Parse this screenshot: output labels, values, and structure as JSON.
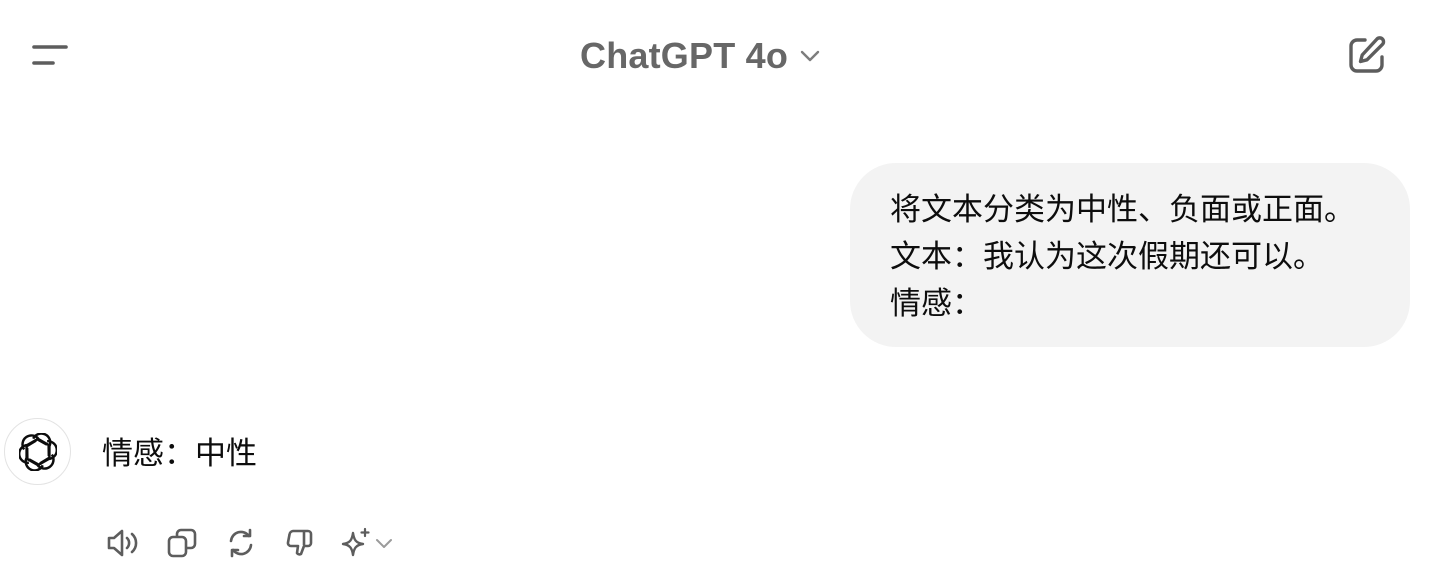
{
  "header": {
    "model_title": "ChatGPT 4o",
    "menu_icon": "sidebar-menu-icon",
    "dropdown_icon": "chevron-down-icon",
    "new_chat_icon": "edit-pencil-icon"
  },
  "conversation": {
    "user_message": {
      "lines": [
        "将文本分类为中性、负面或正面。",
        "文本：我认为这次假期还可以。",
        "情感："
      ]
    },
    "assistant_message": {
      "avatar_icon": "openai-logo-icon",
      "text": "情感：中性"
    },
    "actions": [
      {
        "name": "read-aloud",
        "icon": "speaker-icon"
      },
      {
        "name": "copy",
        "icon": "copy-icon"
      },
      {
        "name": "regenerate",
        "icon": "refresh-icon"
      },
      {
        "name": "bad-response",
        "icon": "thumbs-down-icon"
      },
      {
        "name": "change-model",
        "icon": "sparkle-icon"
      }
    ]
  },
  "colors": {
    "background": "#ffffff",
    "title_gray": "#676767",
    "icon_gray": "#5d5d5d",
    "bubble_bg": "#f3f3f3",
    "text": "#0d0d0d"
  }
}
